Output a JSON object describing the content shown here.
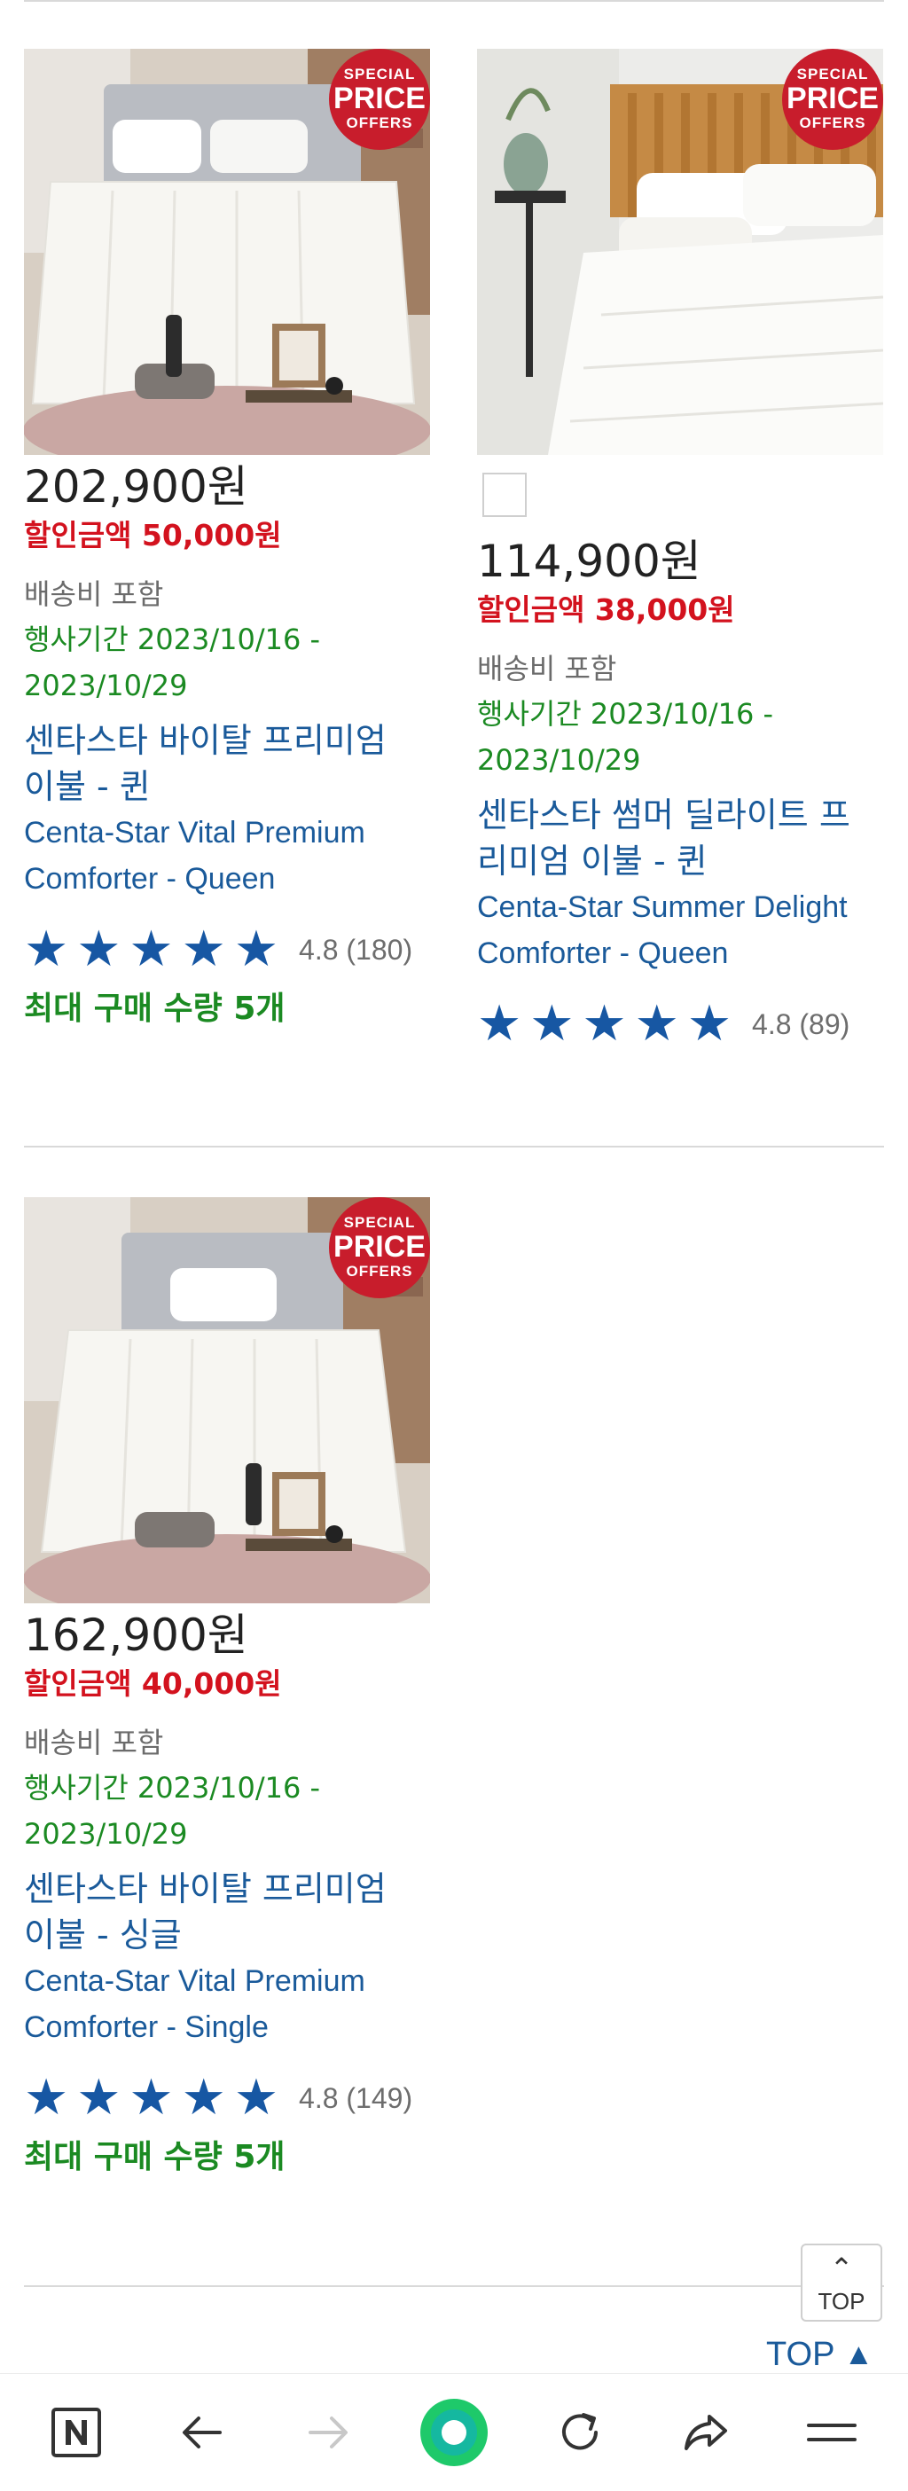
{
  "products": [
    {
      "badge": {
        "line1": "SPECIAL",
        "line2": "PRICE",
        "line3": "OFFERS"
      },
      "price": "202,900원",
      "discount": "할인금액 50,000원",
      "shipping": "배송비 포함",
      "event_line1": "행사기간 2023/10/16 -",
      "event_line2": "2023/10/29",
      "name_ko_1": "센타스타 바이탈 프리미엄",
      "name_ko_2": "이불 - 퀸",
      "name_en_1": "Centa-Star Vital Premium",
      "name_en_2": "Comforter - Queen",
      "rating": "4.8",
      "reviews": "(180)",
      "max_qty": "최대 구매 수량 5개"
    },
    {
      "badge": {
        "line1": "SPECIAL",
        "line2": "PRICE",
        "line3": "OFFERS"
      },
      "price": "114,900원",
      "discount": "할인금액 38,000원",
      "shipping": "배송비 포함",
      "event_line1": "행사기간 2023/10/16 -",
      "event_line2": "2023/10/29",
      "name_ko_1": "센타스타 썸머 딜라이트 프",
      "name_ko_2": "리미엄 이불 - 퀸",
      "name_en_1": "Centa-Star Summer Delight",
      "name_en_2": "Comforter - Queen",
      "rating": "4.8",
      "reviews": "(89)"
    },
    {
      "badge": {
        "line1": "SPECIAL",
        "line2": "PRICE",
        "line3": "OFFERS"
      },
      "price": "162,900원",
      "discount": "할인금액 40,000원",
      "shipping": "배송비 포함",
      "event_line1": "행사기간 2023/10/16 -",
      "event_line2": "2023/10/29",
      "name_ko_1": "센타스타 바이탈 프리미엄",
      "name_ko_2": "이불 - 싱글",
      "name_en_1": "Centa-Star Vital Premium",
      "name_en_2": "Comforter - Single",
      "rating": "4.8",
      "reviews": "(149)",
      "max_qty": "최대 구매 수량 5개"
    }
  ],
  "scroll_top": {
    "box_label": "TOP",
    "link_label": "TOP"
  },
  "colors": {
    "price_blue": "#1a5a9a",
    "discount_red": "#d3121e",
    "event_green": "#1b8a22",
    "star_blue": "#1757a3",
    "badge_red": "#c81d2c"
  },
  "navbar_icons": [
    "naver-icon",
    "back-arrow-icon",
    "forward-arrow-icon",
    "green-home-icon",
    "refresh-icon",
    "share-icon",
    "menu-icon"
  ]
}
